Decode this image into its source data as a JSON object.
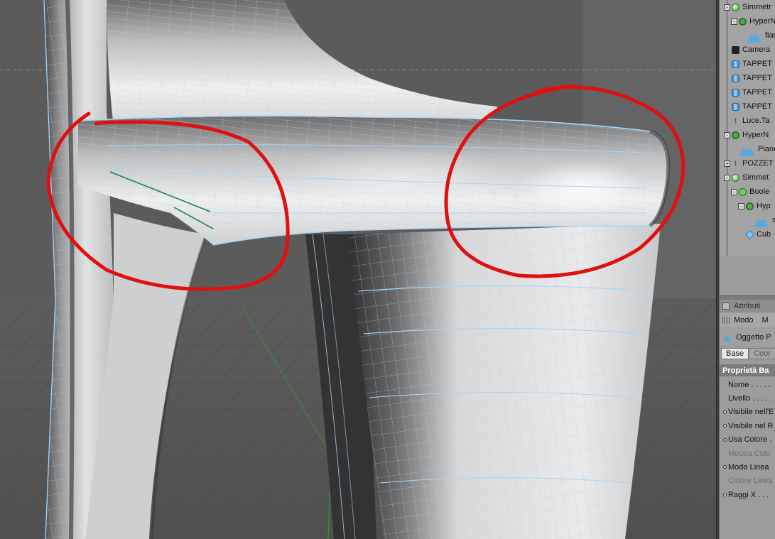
{
  "object_manager": {
    "items": [
      {
        "label": "Simmetr",
        "icon": "symmetry-icon",
        "indent": 0,
        "expander": "-"
      },
      {
        "label": "HyperN",
        "icon": "hypernurbs-icon",
        "indent": 1,
        "expander": "-"
      },
      {
        "label": "fian",
        "icon": "polygon-object-icon",
        "indent": 2,
        "expander": ""
      },
      {
        "label": "Camera",
        "icon": "camera-icon",
        "indent": 0,
        "expander": ""
      },
      {
        "label": "TAPPET",
        "icon": "cylinder-icon",
        "indent": 0,
        "expander": ""
      },
      {
        "label": "TAPPET",
        "icon": "cylinder-icon",
        "indent": 0,
        "expander": ""
      },
      {
        "label": "TAPPET",
        "icon": "cylinder-icon",
        "indent": 0,
        "expander": ""
      },
      {
        "label": "TAPPET",
        "icon": "cylinder-icon",
        "indent": 0,
        "expander": ""
      },
      {
        "label": "Luce.Ta",
        "icon": "light-icon",
        "indent": 0,
        "expander": ""
      },
      {
        "label": "HyperN",
        "icon": "hypernurbs-icon",
        "indent": 0,
        "expander": "-"
      },
      {
        "label": "Piano",
        "icon": "polygon-object-icon",
        "indent": 1,
        "expander": ""
      },
      {
        "label": "POZZET",
        "icon": "light-icon",
        "indent": 0,
        "expander": "+"
      },
      {
        "label": "Simmet",
        "icon": "symmetry-icon",
        "indent": 0,
        "expander": "-"
      },
      {
        "label": "Boole",
        "icon": "boole-icon",
        "indent": 1,
        "expander": "-"
      },
      {
        "label": "Hyp",
        "icon": "hypernurbs-icon",
        "indent": 2,
        "expander": "-"
      },
      {
        "label": "se",
        "icon": "polygon-object-icon",
        "indent": 3,
        "expander": ""
      },
      {
        "label": "Cub",
        "icon": "cube-icon",
        "indent": 2,
        "expander": ""
      }
    ]
  },
  "attributes": {
    "title": "Attributi",
    "menu": [
      "Modo",
      "M"
    ],
    "object_label": "Oggetto P",
    "tabs": [
      "Base",
      "Coor"
    ],
    "section": "Proprietà Ba",
    "properties": [
      {
        "label": "Nome . . . . .",
        "dot": false,
        "disabled": false
      },
      {
        "label": "Livello . . . . .",
        "dot": false,
        "disabled": false
      },
      {
        "label": "Visibile nell'E",
        "dot": true,
        "disabled": false
      },
      {
        "label": "Visibile nel R",
        "dot": true,
        "disabled": false
      },
      {
        "label": "Usa Colore .",
        "dot": true,
        "disabled": false
      },
      {
        "label": "Mostra Colo",
        "dot": false,
        "disabled": true
      },
      {
        "label": "Modo Linea",
        "dot": true,
        "disabled": false
      },
      {
        "label": "Colore Linea",
        "dot": false,
        "disabled": true
      },
      {
        "label": "Raggi X . . .",
        "dot": true,
        "disabled": false
      }
    ]
  },
  "colors": {
    "viewport_bg": "#5a5a5a",
    "mesh_surface": "#dcdcdc",
    "wireframe": "#a9d4f5",
    "annotation": "#e01010",
    "panel_bg": "#a3a3a3"
  }
}
